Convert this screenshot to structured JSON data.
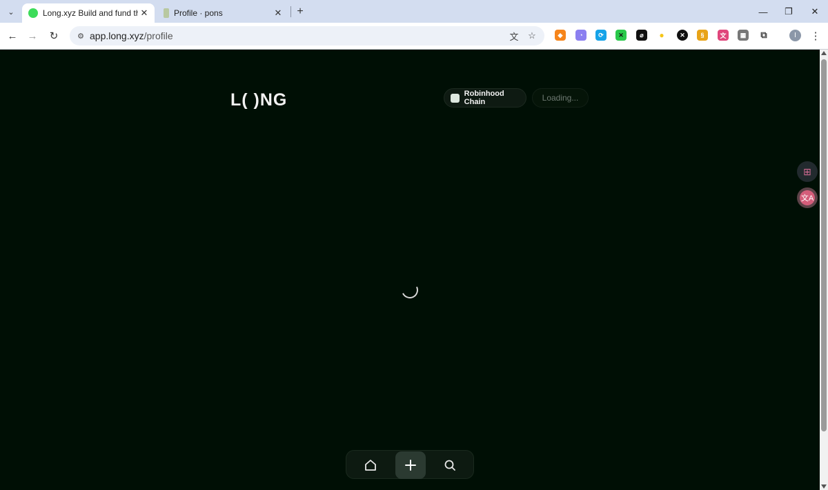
{
  "browser": {
    "tabs": [
      {
        "title": "Long.xyz Build and fund the f",
        "active": true,
        "favicon_color": "#3ddc5a"
      },
      {
        "title": "Profile · pons",
        "active": false,
        "favicon_color": "#b8c8a0"
      }
    ],
    "url_main": "app.long.xyz",
    "url_path": "/profile",
    "new_tab_glyph": "+",
    "close_glyph": "✕",
    "extensions": [
      {
        "name": "metamask-icon",
        "color": "#f6851b",
        "glyph": "🦊"
      },
      {
        "name": "phantom-icon",
        "color": "#8b7ff0",
        "glyph": "◔"
      },
      {
        "name": "sync-icon",
        "color": "#16a3e8",
        "glyph": "⟳"
      },
      {
        "name": "grid-extension-icon",
        "color": "#29c94a",
        "glyph": "✕"
      },
      {
        "name": "slash-extension-icon",
        "color": "#111111",
        "glyph": "⌀"
      },
      {
        "name": "dots-extension-icon",
        "color": "#f5c518",
        "glyph": "●"
      },
      {
        "name": "x-extension-icon",
        "color": "#111111",
        "glyph": "✕"
      },
      {
        "name": "bolt-extension-icon",
        "color": "#e8a317",
        "glyph": "§"
      },
      {
        "name": "translate-extension-icon",
        "color": "#e0457b",
        "glyph": "文"
      },
      {
        "name": "qr-extension-icon",
        "color": "#777777",
        "glyph": "▦"
      },
      {
        "name": "puzzle-icon",
        "color": "#444444",
        "glyph": "⧉"
      }
    ],
    "profile_initial": "I"
  },
  "page": {
    "logo": "L( )NG",
    "chain_label": "Robinhood Chain",
    "loading_label": "Loading..."
  },
  "colors": {
    "background": "#000f05",
    "accent": "#d45d7a"
  }
}
